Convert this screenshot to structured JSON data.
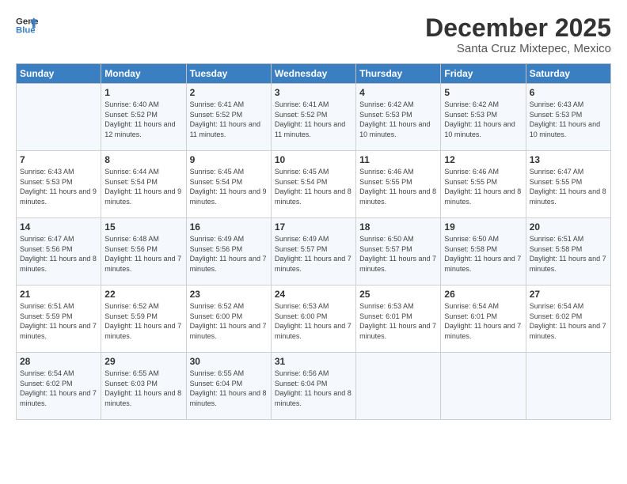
{
  "logo": {
    "line1": "General",
    "line2": "Blue"
  },
  "title": "December 2025",
  "location": "Santa Cruz Mixtepec, Mexico",
  "days_header": [
    "Sunday",
    "Monday",
    "Tuesday",
    "Wednesday",
    "Thursday",
    "Friday",
    "Saturday"
  ],
  "weeks": [
    [
      {
        "num": "",
        "sunrise": "",
        "sunset": "",
        "daylight": ""
      },
      {
        "num": "1",
        "sunrise": "Sunrise: 6:40 AM",
        "sunset": "Sunset: 5:52 PM",
        "daylight": "Daylight: 11 hours and 12 minutes."
      },
      {
        "num": "2",
        "sunrise": "Sunrise: 6:41 AM",
        "sunset": "Sunset: 5:52 PM",
        "daylight": "Daylight: 11 hours and 11 minutes."
      },
      {
        "num": "3",
        "sunrise": "Sunrise: 6:41 AM",
        "sunset": "Sunset: 5:52 PM",
        "daylight": "Daylight: 11 hours and 11 minutes."
      },
      {
        "num": "4",
        "sunrise": "Sunrise: 6:42 AM",
        "sunset": "Sunset: 5:53 PM",
        "daylight": "Daylight: 11 hours and 10 minutes."
      },
      {
        "num": "5",
        "sunrise": "Sunrise: 6:42 AM",
        "sunset": "Sunset: 5:53 PM",
        "daylight": "Daylight: 11 hours and 10 minutes."
      },
      {
        "num": "6",
        "sunrise": "Sunrise: 6:43 AM",
        "sunset": "Sunset: 5:53 PM",
        "daylight": "Daylight: 11 hours and 10 minutes."
      }
    ],
    [
      {
        "num": "7",
        "sunrise": "Sunrise: 6:43 AM",
        "sunset": "Sunset: 5:53 PM",
        "daylight": "Daylight: 11 hours and 9 minutes."
      },
      {
        "num": "8",
        "sunrise": "Sunrise: 6:44 AM",
        "sunset": "Sunset: 5:54 PM",
        "daylight": "Daylight: 11 hours and 9 minutes."
      },
      {
        "num": "9",
        "sunrise": "Sunrise: 6:45 AM",
        "sunset": "Sunset: 5:54 PM",
        "daylight": "Daylight: 11 hours and 9 minutes."
      },
      {
        "num": "10",
        "sunrise": "Sunrise: 6:45 AM",
        "sunset": "Sunset: 5:54 PM",
        "daylight": "Daylight: 11 hours and 8 minutes."
      },
      {
        "num": "11",
        "sunrise": "Sunrise: 6:46 AM",
        "sunset": "Sunset: 5:55 PM",
        "daylight": "Daylight: 11 hours and 8 minutes."
      },
      {
        "num": "12",
        "sunrise": "Sunrise: 6:46 AM",
        "sunset": "Sunset: 5:55 PM",
        "daylight": "Daylight: 11 hours and 8 minutes."
      },
      {
        "num": "13",
        "sunrise": "Sunrise: 6:47 AM",
        "sunset": "Sunset: 5:55 PM",
        "daylight": "Daylight: 11 hours and 8 minutes."
      }
    ],
    [
      {
        "num": "14",
        "sunrise": "Sunrise: 6:47 AM",
        "sunset": "Sunset: 5:56 PM",
        "daylight": "Daylight: 11 hours and 8 minutes."
      },
      {
        "num": "15",
        "sunrise": "Sunrise: 6:48 AM",
        "sunset": "Sunset: 5:56 PM",
        "daylight": "Daylight: 11 hours and 7 minutes."
      },
      {
        "num": "16",
        "sunrise": "Sunrise: 6:49 AM",
        "sunset": "Sunset: 5:56 PM",
        "daylight": "Daylight: 11 hours and 7 minutes."
      },
      {
        "num": "17",
        "sunrise": "Sunrise: 6:49 AM",
        "sunset": "Sunset: 5:57 PM",
        "daylight": "Daylight: 11 hours and 7 minutes."
      },
      {
        "num": "18",
        "sunrise": "Sunrise: 6:50 AM",
        "sunset": "Sunset: 5:57 PM",
        "daylight": "Daylight: 11 hours and 7 minutes."
      },
      {
        "num": "19",
        "sunrise": "Sunrise: 6:50 AM",
        "sunset": "Sunset: 5:58 PM",
        "daylight": "Daylight: 11 hours and 7 minutes."
      },
      {
        "num": "20",
        "sunrise": "Sunrise: 6:51 AM",
        "sunset": "Sunset: 5:58 PM",
        "daylight": "Daylight: 11 hours and 7 minutes."
      }
    ],
    [
      {
        "num": "21",
        "sunrise": "Sunrise: 6:51 AM",
        "sunset": "Sunset: 5:59 PM",
        "daylight": "Daylight: 11 hours and 7 minutes."
      },
      {
        "num": "22",
        "sunrise": "Sunrise: 6:52 AM",
        "sunset": "Sunset: 5:59 PM",
        "daylight": "Daylight: 11 hours and 7 minutes."
      },
      {
        "num": "23",
        "sunrise": "Sunrise: 6:52 AM",
        "sunset": "Sunset: 6:00 PM",
        "daylight": "Daylight: 11 hours and 7 minutes."
      },
      {
        "num": "24",
        "sunrise": "Sunrise: 6:53 AM",
        "sunset": "Sunset: 6:00 PM",
        "daylight": "Daylight: 11 hours and 7 minutes."
      },
      {
        "num": "25",
        "sunrise": "Sunrise: 6:53 AM",
        "sunset": "Sunset: 6:01 PM",
        "daylight": "Daylight: 11 hours and 7 minutes."
      },
      {
        "num": "26",
        "sunrise": "Sunrise: 6:54 AM",
        "sunset": "Sunset: 6:01 PM",
        "daylight": "Daylight: 11 hours and 7 minutes."
      },
      {
        "num": "27",
        "sunrise": "Sunrise: 6:54 AM",
        "sunset": "Sunset: 6:02 PM",
        "daylight": "Daylight: 11 hours and 7 minutes."
      }
    ],
    [
      {
        "num": "28",
        "sunrise": "Sunrise: 6:54 AM",
        "sunset": "Sunset: 6:02 PM",
        "daylight": "Daylight: 11 hours and 7 minutes."
      },
      {
        "num": "29",
        "sunrise": "Sunrise: 6:55 AM",
        "sunset": "Sunset: 6:03 PM",
        "daylight": "Daylight: 11 hours and 8 minutes."
      },
      {
        "num": "30",
        "sunrise": "Sunrise: 6:55 AM",
        "sunset": "Sunset: 6:04 PM",
        "daylight": "Daylight: 11 hours and 8 minutes."
      },
      {
        "num": "31",
        "sunrise": "Sunrise: 6:56 AM",
        "sunset": "Sunset: 6:04 PM",
        "daylight": "Daylight: 11 hours and 8 minutes."
      },
      {
        "num": "",
        "sunrise": "",
        "sunset": "",
        "daylight": ""
      },
      {
        "num": "",
        "sunrise": "",
        "sunset": "",
        "daylight": ""
      },
      {
        "num": "",
        "sunrise": "",
        "sunset": "",
        "daylight": ""
      }
    ]
  ]
}
